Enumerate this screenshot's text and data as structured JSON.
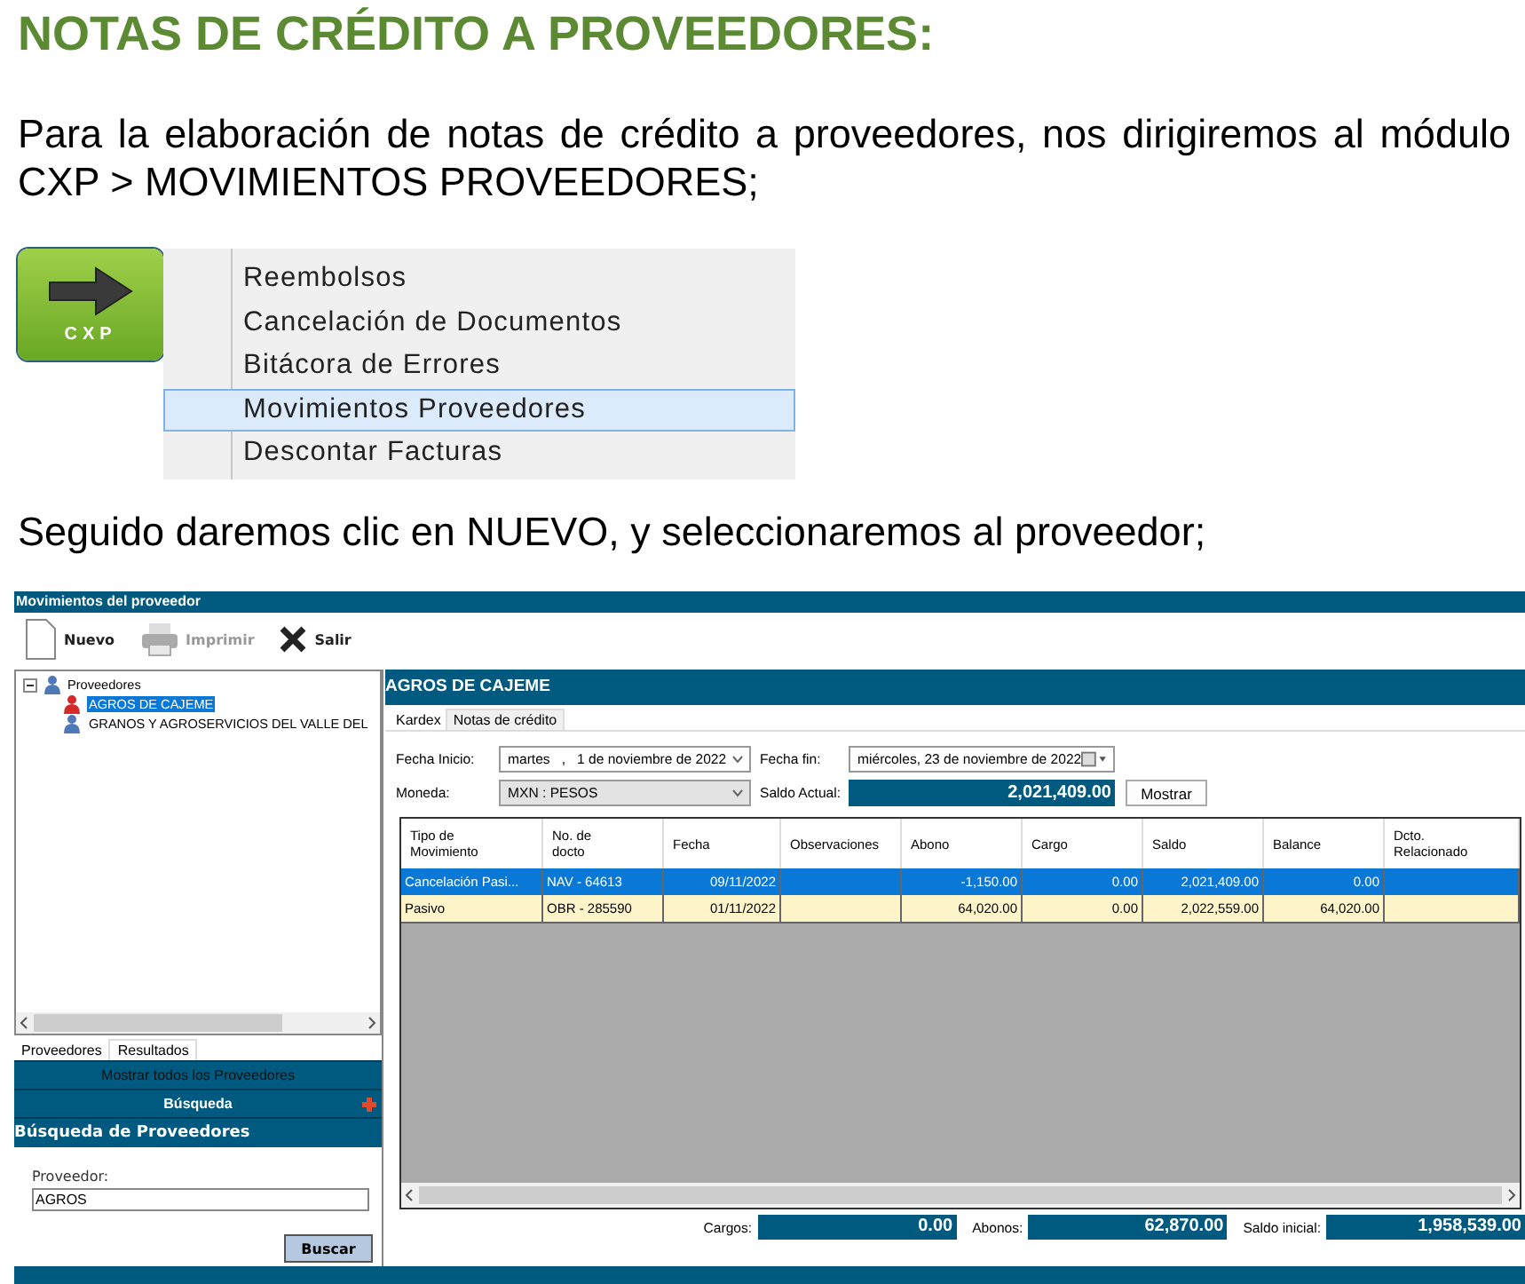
{
  "heading": "NOTAS DE CRÉDITO A PROVEEDORES:",
  "intro": "Para la elaboración de notas de crédito a proveedores, nos dirigiremos al módulo CXP >  MOVIMIENTOS PROVEEDORES;",
  "module_menu": {
    "tile_label": "CXP",
    "items": [
      {
        "label": "Reembolsos",
        "selected": false
      },
      {
        "label": "Cancelación de Documentos",
        "selected": false
      },
      {
        "label": "Bitácora de Errores",
        "selected": false
      },
      {
        "label": "Movimientos Proveedores",
        "selected": true
      },
      {
        "label": "Descontar Facturas",
        "selected": false
      }
    ]
  },
  "instruction": "Seguido daremos clic en NUEVO, y seleccionaremos al proveedor;",
  "window": {
    "title": "Movimientos del proveedor",
    "toolbar": [
      {
        "kind": "new",
        "label": "Nuevo",
        "disabled": false
      },
      {
        "kind": "print",
        "label": "Imprimir",
        "disabled": true
      },
      {
        "kind": "exit",
        "label": "Salir",
        "disabled": false
      }
    ],
    "tree": {
      "label": "Proveedores",
      "expanded": true,
      "children": [
        {
          "label": "AGROS DE CAJEME",
          "selected": true
        },
        {
          "label": "GRANOS Y AGROSERVICIOS DEL VALLE DEL",
          "selected": false
        }
      ]
    },
    "left_tabs": [
      {
        "label": "Proveedores",
        "selected": true
      },
      {
        "label": "Resultados",
        "selected": false
      }
    ],
    "show_all": "Mostrar todos los Proveedores",
    "search_bar": "Búsqueda",
    "search_title": "Búsqueda de Proveedores",
    "search_field": {
      "label": "Proveedor:",
      "value": "AGROS"
    },
    "search_button": "Buscar",
    "detail": {
      "title": "AGROS DE CAJEME",
      "tabs": [
        {
          "label": "Kardex",
          "selected": true
        },
        {
          "label": "Notas de crédito",
          "selected": false
        }
      ],
      "start_label": "Fecha Inicio:",
      "start_value": "martes   ,   1 de noviembre de 2022",
      "end_label": "Fecha fin:",
      "end_value": "miércoles, 23 de noviembre de 2022",
      "currency_label": "Moneda:",
      "currency_value": "MXN : PESOS",
      "balance_label": "Saldo Actual:",
      "balance_value": "2,021,409.00",
      "show_button": "Mostrar",
      "table": {
        "columns": [
          "Tipo de Movimiento",
          "No. de docto",
          "Fecha",
          "Observaciones",
          "Abono",
          "Cargo",
          "Saldo",
          "Balance",
          "Dcto. Relacionado"
        ],
        "rows": [
          {
            "cells": [
              "Cancelación Pasi...",
              "NAV - 64613",
              "09/11/2022",
              "",
              "-1,150.00",
              "0.00",
              "2,021,409.00",
              "0.00",
              ""
            ],
            "selected": true
          },
          {
            "cells": [
              "Pasivo",
              "OBR - 285590",
              "01/11/2022",
              "",
              "64,020.00",
              "0.00",
              "2,022,559.00",
              "64,020.00",
              ""
            ],
            "selected": false
          }
        ]
      },
      "totals": [
        {
          "label": "Cargos:",
          "value": "0.00"
        },
        {
          "label": "Abonos:",
          "value": "62,870.00"
        },
        {
          "label": "Saldo inicial:",
          "value": "1,958,539.00"
        }
      ]
    }
  }
}
